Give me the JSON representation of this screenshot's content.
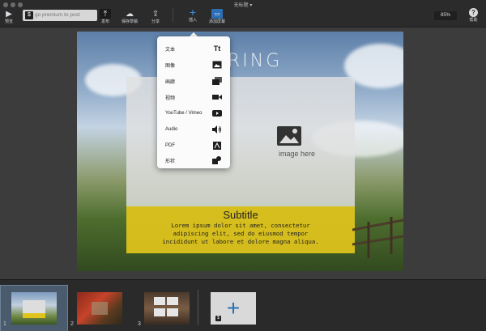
{
  "window": {
    "title": "无标题"
  },
  "toolbar": {
    "preview_label": "预览",
    "publish_placeholder": "go premium to post",
    "publish_label": "发布",
    "save_cloud_label": "保存草稿",
    "share_label": "分享",
    "insert_label": "插入",
    "add_slide_label": "添加屏幕",
    "zoom_value": "85%",
    "help_label": "帮助"
  },
  "slide": {
    "title": "RING",
    "placeholder_text": "image here",
    "subtitle": "Subtitle",
    "body_lines": [
      "Lorem ipsum dolor sit amet, consectetur",
      "adipiscing elit, sed do eiusmod tempor",
      "incididunt ut labore et dolore magna aliqua."
    ]
  },
  "insert_menu": {
    "items": [
      {
        "label": "文本",
        "icon": "Tt",
        "icon_name": "text-icon"
      },
      {
        "label": "图像",
        "icon": "▲",
        "icon_name": "image-icon"
      },
      {
        "label": "画廊",
        "icon": "▣",
        "icon_name": "gallery-icon"
      },
      {
        "label": "视频",
        "icon": "■",
        "icon_name": "video-icon"
      },
      {
        "label": "YouTube / Vimeo",
        "icon": "▶",
        "icon_name": "youtube-icon"
      },
      {
        "label": "Audio",
        "icon": "◀)",
        "icon_name": "audio-icon"
      },
      {
        "label": "PDF",
        "icon": "⎘",
        "icon_name": "pdf-icon"
      },
      {
        "label": "形状",
        "icon": "◆",
        "icon_name": "shape-icon"
      }
    ]
  },
  "filmstrip": {
    "slides": [
      {
        "number": "1"
      },
      {
        "number": "2"
      },
      {
        "number": "3"
      }
    ]
  },
  "colors": {
    "accent_blue": "#2d6fb4",
    "subtitle_band": "#e0c41c"
  }
}
